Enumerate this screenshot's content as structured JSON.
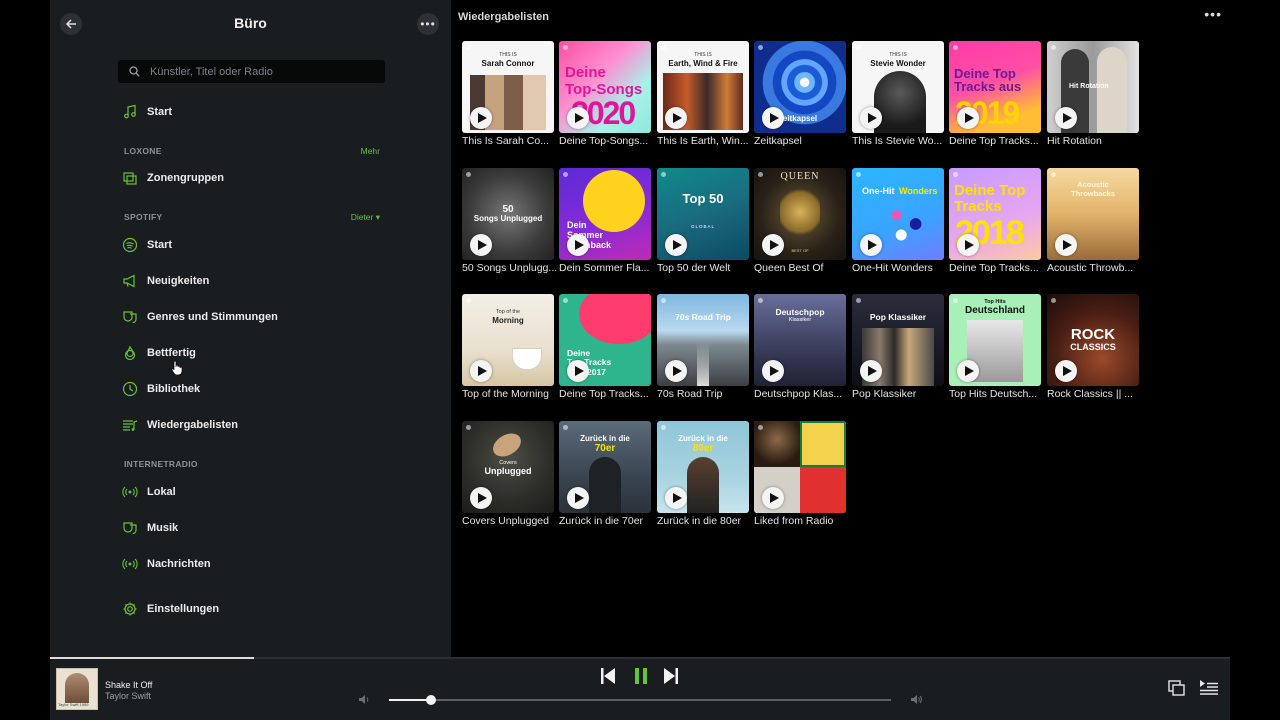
{
  "sidebar": {
    "title": "Büro",
    "search_placeholder": "Künstler, Titel oder Radio",
    "start": "Start",
    "loxone": {
      "heading": "LOXONE",
      "link": "Mehr",
      "zonengruppen": "Zonengruppen"
    },
    "spotify": {
      "heading": "SPOTIFY",
      "user": "Dieter ▾",
      "items": [
        "Start",
        "Neuigkeiten",
        "Genres und Stimmungen",
        "Bettfertig",
        "Bibliothek",
        "Wiedergabelisten"
      ]
    },
    "internetradio": {
      "heading": "INTERNETRADIO",
      "items": [
        "Lokal",
        "Musik",
        "Nachrichten"
      ]
    },
    "settings": "Einstellungen"
  },
  "main": {
    "title": "Wiedergabelisten",
    "tiles": [
      {
        "caption": "This Is Sarah Co...",
        "art": [
          "THIS IS",
          "Sarah Connor"
        ]
      },
      {
        "caption": "Deine Top-Songs...",
        "art": [
          "Deine",
          "Top-Songs",
          "2020"
        ]
      },
      {
        "caption": "This Is Earth, Win...",
        "art": [
          "THIS IS",
          "Earth, Wind & Fire"
        ]
      },
      {
        "caption": "Zeitkapsel",
        "art": [
          "Zeitkapsel"
        ]
      },
      {
        "caption": "This Is Stevie Wo...",
        "art": [
          "THIS IS",
          "Stevie Wonder"
        ]
      },
      {
        "caption": "Deine Top Tracks...",
        "art": [
          "Deine Top",
          "Tracks aus",
          "2019"
        ]
      },
      {
        "caption": "Hit Rotation",
        "art": [
          "Hit Rotation"
        ]
      },
      {
        "caption": "50 Songs Unplugg...",
        "art": [
          "50",
          "Songs Unplugged"
        ]
      },
      {
        "caption": "Dein Sommer Fla...",
        "art": [
          "Dein",
          "Sommer",
          "Flashback"
        ]
      },
      {
        "caption": "Top 50 der Welt",
        "art": [
          "Top 50",
          "GLOBAL"
        ]
      },
      {
        "caption": "Queen Best Of",
        "art": [
          "QUEEN",
          "BEST OF"
        ]
      },
      {
        "caption": "One-Hit Wonders",
        "art": [
          "One-Hit",
          "Wonders"
        ]
      },
      {
        "caption": "Deine Top Tracks...",
        "art": [
          "Deine Top",
          "Tracks",
          "2018"
        ]
      },
      {
        "caption": "Acoustic Throwb...",
        "art": [
          "Acoustic",
          "Throwbacks"
        ]
      },
      {
        "caption": "Top of the Morning",
        "art": [
          "Top of the",
          "Morning"
        ]
      },
      {
        "caption": "Deine Top Tracks...",
        "art": [
          "Deine",
          "Top Tracks",
          "2017"
        ]
      },
      {
        "caption": "70s Road Trip",
        "art": [
          "70s Road Trip"
        ]
      },
      {
        "caption": "Deutschpop Klas...",
        "art": [
          "Deutschpop",
          "Klassiker"
        ]
      },
      {
        "caption": "Pop Klassiker",
        "art": [
          "Pop Klassiker"
        ]
      },
      {
        "caption": "Top Hits Deutsch...",
        "art": [
          "Top Hits",
          "Deutschland"
        ]
      },
      {
        "caption": "Rock Classics || ...",
        "art": [
          "ROCK",
          "CLASSICS"
        ]
      },
      {
        "caption": "Covers Unplugged",
        "art": [
          "Covers",
          "Unplugged"
        ]
      },
      {
        "caption": "Zurück in die 70er",
        "art": [
          "Zurück in die",
          "70er"
        ]
      },
      {
        "caption": "Zurück in die 80er",
        "art": [
          "Zurück in die",
          "80er"
        ]
      },
      {
        "caption": "Liked from Radio",
        "art": []
      }
    ]
  },
  "player": {
    "title": "Shake It Off",
    "artist": "Taylor Swift",
    "cover_text": "Taylor Swift 1989"
  },
  "colors": {
    "accent": "#67c23a",
    "sidebar_bg": "#1a1d20",
    "main_bg": "#000000"
  }
}
